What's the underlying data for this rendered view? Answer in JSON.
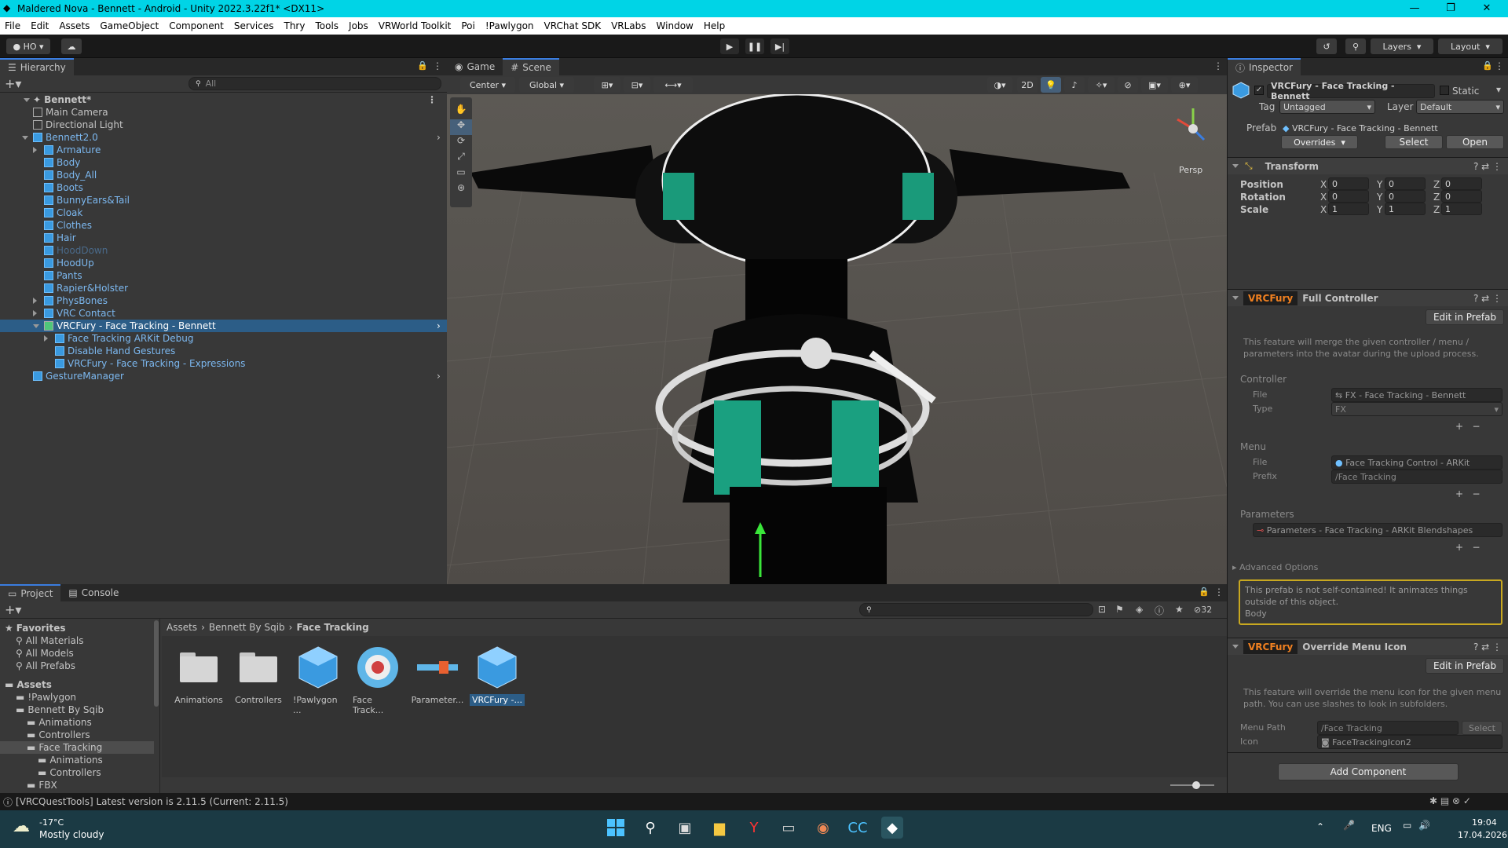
{
  "window": {
    "title": "Maldered Nova - Bennett - Android - Unity 2022.3.22f1* <DX11>",
    "minimize": "—",
    "maximize": "❐",
    "close": "✕"
  },
  "menu": [
    "File",
    "Edit",
    "Assets",
    "GameObject",
    "Component",
    "Services",
    "Thry",
    "Tools",
    "Jobs",
    "VRWorld Toolkit",
    "Poi",
    "!Pawlygon",
    "VRChat SDK",
    "VRLabs",
    "Window",
    "Help"
  ],
  "toolbar": {
    "account": "HO",
    "layers": "Layers",
    "layout": "Layout"
  },
  "hierarchy": {
    "tab": "Hierarchy",
    "search_placeholder": "All",
    "scene": "Bennett*",
    "items": [
      {
        "label": "Main Camera",
        "indent": 1
      },
      {
        "label": "Directional Light",
        "indent": 1
      },
      {
        "label": "Bennett2.0",
        "indent": 1,
        "blue": true,
        "expanded": true
      },
      {
        "label": "Armature",
        "indent": 2,
        "blue": true,
        "arrow": true
      },
      {
        "label": "Body",
        "indent": 2,
        "blue": true
      },
      {
        "label": "Body_All",
        "indent": 2,
        "blue": true
      },
      {
        "label": "Boots",
        "indent": 2,
        "blue": true
      },
      {
        "label": "BunnyEars&Tail",
        "indent": 2,
        "blue": true
      },
      {
        "label": "Cloak",
        "indent": 2,
        "blue": true
      },
      {
        "label": "Clothes",
        "indent": 2,
        "blue": true
      },
      {
        "label": "Hair",
        "indent": 2,
        "blue": true
      },
      {
        "label": "HoodDown",
        "indent": 2,
        "blue": true,
        "faded": true
      },
      {
        "label": "HoodUp",
        "indent": 2,
        "blue": true
      },
      {
        "label": "Pants",
        "indent": 2,
        "blue": true
      },
      {
        "label": "Rapier&Holster",
        "indent": 2,
        "blue": true
      },
      {
        "label": "PhysBones",
        "indent": 2,
        "blue": true,
        "arrow": true
      },
      {
        "label": "VRC Contact",
        "indent": 2,
        "blue": true,
        "arrow": true
      },
      {
        "label": "VRCFury - Face Tracking - Bennett",
        "indent": 2,
        "selected": true,
        "expanded": true
      },
      {
        "label": "Face Tracking ARKit Debug",
        "indent": 3,
        "blue": true,
        "arrow": true
      },
      {
        "label": "Disable Hand Gestures",
        "indent": 3,
        "blue": true
      },
      {
        "label": "VRCFury - Face Tracking - Expressions",
        "indent": 3,
        "blue": true
      },
      {
        "label": "GestureManager",
        "indent": 1,
        "blue": true
      }
    ]
  },
  "scene_view": {
    "tabs": [
      "Game",
      "Scene"
    ],
    "pivot": "Center",
    "space": "Global",
    "mode2d": "2D",
    "persp": "Persp"
  },
  "inspector": {
    "tab": "Inspector",
    "object_name": "VRCFury - Face Tracking - Bennett",
    "static": "Static",
    "tag_label": "Tag",
    "tag": "Untagged",
    "layer_label": "Layer",
    "layer": "Default",
    "prefab_label": "Prefab",
    "prefab": "VRCFury - Face Tracking - Bennett",
    "overrides": "Overrides",
    "select": "Select",
    "open": "Open",
    "transform": {
      "title": "Transform",
      "rows": [
        {
          "label": "Position",
          "x": "0",
          "y": "0",
          "z": "0"
        },
        {
          "label": "Rotation",
          "x": "0",
          "y": "0",
          "z": "0"
        },
        {
          "label": "Scale",
          "x": "1",
          "y": "1",
          "z": "1"
        }
      ]
    },
    "vrcfury1": {
      "brand": "VRCFury",
      "title": "Full Controller",
      "edit": "Edit in Prefab",
      "desc": "This feature will merge the given controller / menu / parameters into the avatar during the upload process.",
      "controller_label": "Controller",
      "file_label": "File",
      "file": "FX - Face Tracking - Bennett",
      "type_label": "Type",
      "type": "FX",
      "menu_label": "Menu",
      "menu_file": "Face Tracking Control - ARKit",
      "prefix_label": "Prefix",
      "prefix": "/Face Tracking",
      "params_label": "Parameters",
      "params": "Parameters - Face Tracking - ARKit Blendshapes",
      "advanced": "Advanced Options",
      "warning": "This prefab is not self-contained! It animates things outside of this object.",
      "warning_extra": "Body"
    },
    "vrcfury2": {
      "brand": "VRCFury",
      "title": "Override Menu Icon",
      "edit": "Edit in Prefab",
      "desc": "This feature will override the menu icon for the given menu path. You can use slashes to look in subfolders.",
      "path_label": "Menu Path",
      "path": "/Face Tracking",
      "path_select": "Select",
      "icon_label": "Icon",
      "icon": "FaceTrackingIcon2"
    },
    "add_component": "Add Component"
  },
  "project": {
    "tabs": [
      "Project",
      "Console"
    ],
    "count": "32",
    "breadcrumb": [
      "Assets",
      "Bennett By Sqib",
      "Face Tracking"
    ],
    "tree": [
      {
        "label": "Favorites",
        "indent": 0,
        "bold": true
      },
      {
        "label": "All Materials",
        "indent": 1
      },
      {
        "label": "All Models",
        "indent": 1
      },
      {
        "label": "All Prefabs",
        "indent": 1
      },
      {
        "label": "Assets",
        "indent": 0,
        "bold": true
      },
      {
        "label": "!Pawlygon",
        "indent": 1
      },
      {
        "label": "Bennett By Sqib",
        "indent": 1
      },
      {
        "label": "Animations",
        "indent": 2
      },
      {
        "label": "Controllers",
        "indent": 2
      },
      {
        "label": "Face Tracking",
        "indent": 2,
        "selected": true
      },
      {
        "label": "Animations",
        "indent": 3
      },
      {
        "label": "Controllers",
        "indent": 3
      },
      {
        "label": "FBX",
        "indent": 2
      }
    ],
    "assets": [
      {
        "label": "Animations",
        "kind": "folder"
      },
      {
        "label": "Controllers",
        "kind": "folder"
      },
      {
        "label": "!Pawlygon ...",
        "kind": "cube"
      },
      {
        "label": "Face Track...",
        "kind": "target"
      },
      {
        "label": "Parameter...",
        "kind": "param"
      },
      {
        "label": "VRCFury -...",
        "kind": "cube",
        "selected": true
      }
    ]
  },
  "status": "[VRCQuestTools] Latest version is 2.11.5 (Current: 2.11.5)",
  "taskbar": {
    "temp": "-17°C",
    "weather": "Mostly cloudy",
    "lang": "ENG",
    "time": "19:04",
    "date": "17.04.2026"
  }
}
